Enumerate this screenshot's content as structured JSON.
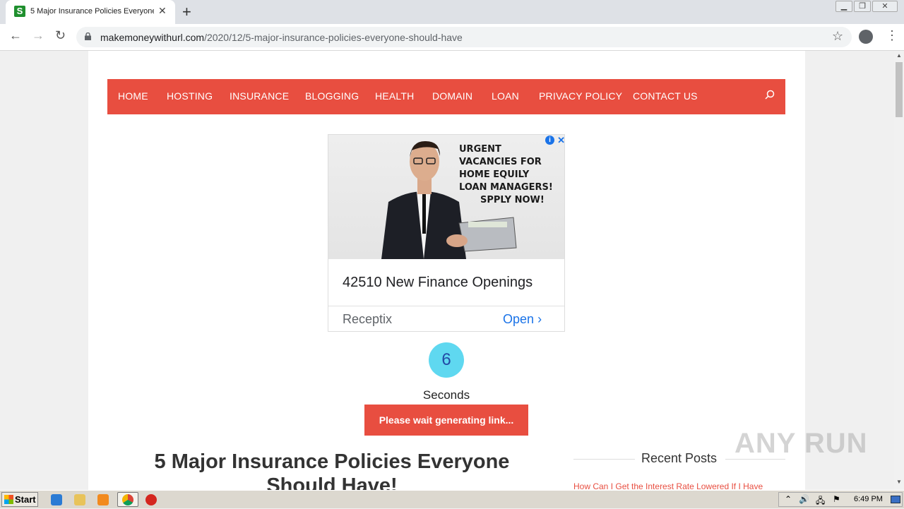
{
  "browser": {
    "tab_title": "5 Major Insurance Policies Everyone Should Have",
    "favicon_letter": "S",
    "url_host": "makemoneywithurl.com",
    "url_path": "/2020/12/5-major-insurance-policies-everyone-should-have"
  },
  "nav": {
    "items": [
      "HOME",
      "HOSTING",
      "INSURANCE",
      "BLOGGING",
      "HEALTH",
      "DOMAIN",
      "LOAN",
      "PRIVACY POLICY",
      "CONTACT US"
    ]
  },
  "ad": {
    "image_text": [
      "URGENT",
      "VACANCIES FOR",
      "HOME EQUILY",
      "LOAN MANAGERS!",
      "SPPLY NOW!"
    ],
    "headline": "42510 New Finance Openings",
    "advertiser": "Receptix",
    "cta": "Open"
  },
  "countdown": {
    "value": "6",
    "label": "Seconds",
    "button": "Please wait generating link..."
  },
  "post": {
    "title": "5 Major Insurance Policies Everyone Should Have!"
  },
  "sidebar": {
    "recent_title": "Recent Posts",
    "recent_first": "How Can I Get the Interest Rate Lowered If I Have"
  },
  "watermark": "ANY RUN",
  "taskbar": {
    "start": "Start",
    "clock": "6:49 PM"
  },
  "colors": {
    "accent": "#e84e40",
    "countdown_bg": "#5fd8f0",
    "ad_link": "#1a73e8"
  }
}
